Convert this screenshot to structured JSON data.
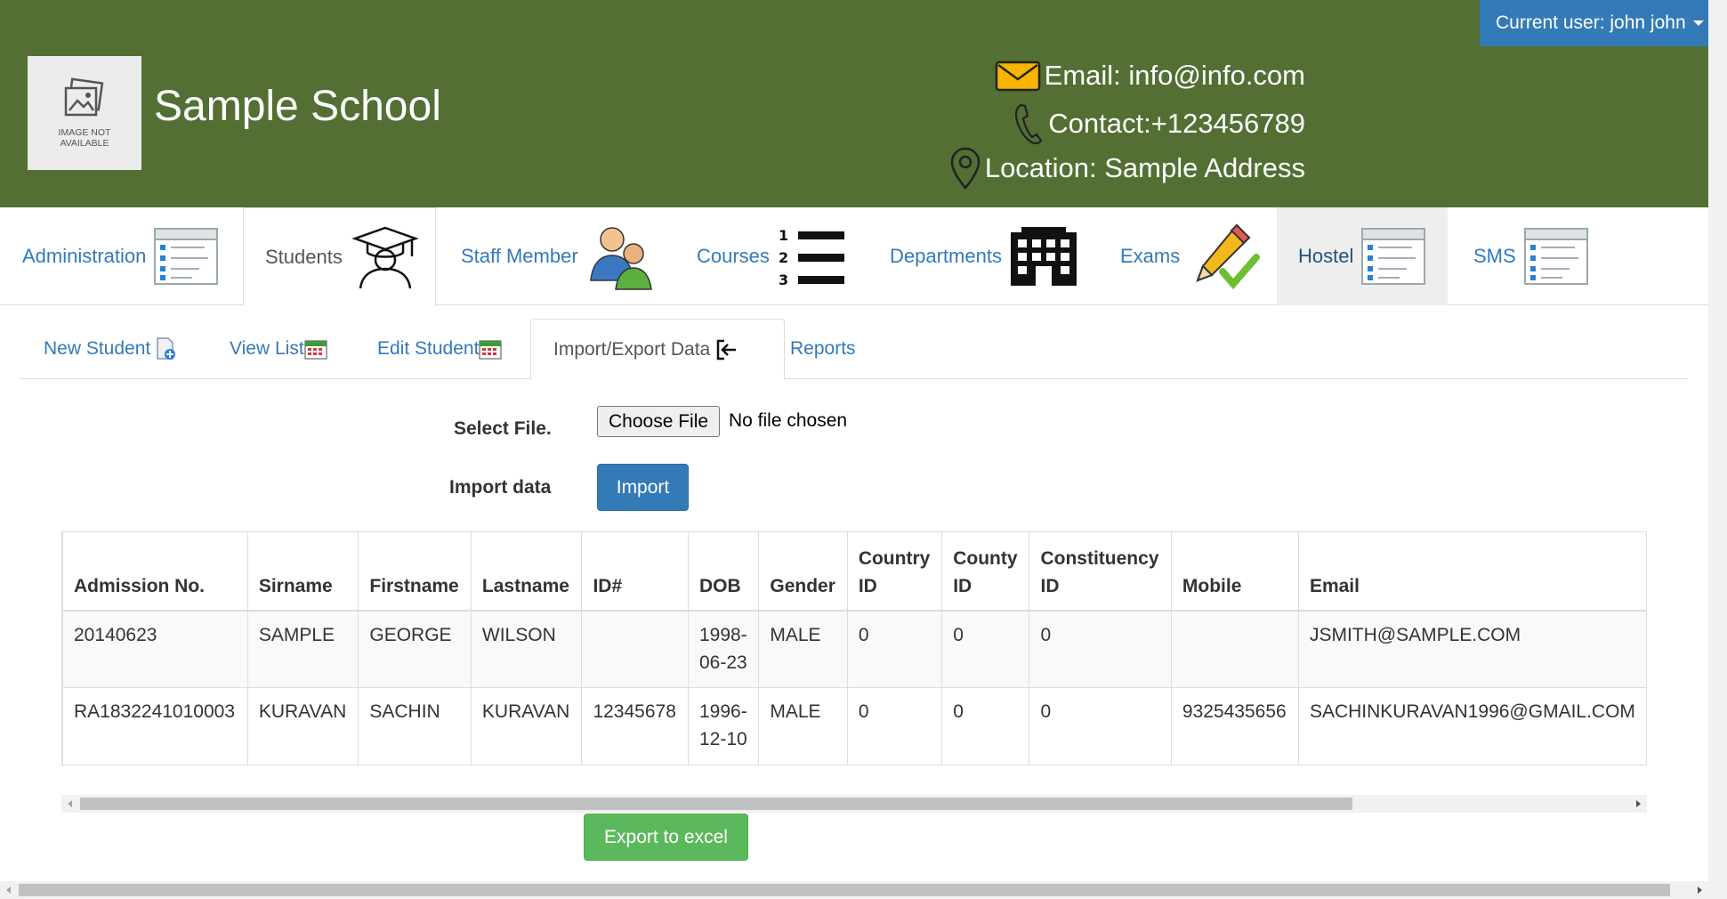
{
  "header": {
    "school_name": "Sample School",
    "logo_text_line1": "IMAGE NOT",
    "logo_text_line2": "AVAILABLE",
    "user_label": "Current user: john john",
    "email": "Email: info@info.com",
    "contact": "Contact:+123456789",
    "location": "Location: Sample Address",
    "bg_color": "#536f34"
  },
  "main_nav": [
    {
      "label": "Administration",
      "icon": "list-window-icon"
    },
    {
      "label": "Students",
      "icon": "graduate-icon"
    },
    {
      "label": "Staff Member",
      "icon": "users-icon"
    },
    {
      "label": "Courses",
      "icon": "numbered-list-icon"
    },
    {
      "label": "Departments",
      "icon": "building-icon"
    },
    {
      "label": "Exams",
      "icon": "pencil-check-icon"
    },
    {
      "label": "Hostel",
      "icon": "list-window-icon"
    },
    {
      "label": "SMS",
      "icon": "list-window-icon"
    }
  ],
  "sub_nav": [
    {
      "label": "New Student",
      "icon": "add-document-icon"
    },
    {
      "label": "View List",
      "icon": "calendar-icon"
    },
    {
      "label": "Edit Student",
      "icon": "calendar-icon"
    },
    {
      "label": "Import/Export Data",
      "icon": "sign-in-icon"
    },
    {
      "label": "Reports"
    }
  ],
  "form": {
    "select_file_label": "Select File.",
    "choose_file_label": "Choose File",
    "file_status": "No file chosen",
    "import_label": "Import data",
    "import_button": "Import"
  },
  "table": {
    "headers": [
      "Admission No.",
      "Sirname",
      "Firstname",
      "Lastname",
      "ID#",
      "DOB",
      "Gender",
      "Country ID",
      "County ID",
      "Constituency ID",
      "Mobile",
      "Email"
    ],
    "rows": [
      [
        "20140623",
        "SAMPLE",
        "GEORGE",
        "WILSON",
        "",
        "1998-06-23",
        "MALE",
        "0",
        "0",
        "0",
        "",
        "JSMITH@SAMPLE.COM"
      ],
      [
        "RA1832241010003",
        "KURAVAN",
        "SACHIN",
        "KURAVAN",
        "12345678",
        "1996-12-10",
        "MALE",
        "0",
        "0",
        "0",
        "9325435656",
        "SACHINKURAVAN1996@GMAIL.COM"
      ]
    ]
  },
  "export_button": "Export to excel",
  "colors": {
    "primary": "#337ab7",
    "success": "#5cb85c"
  }
}
